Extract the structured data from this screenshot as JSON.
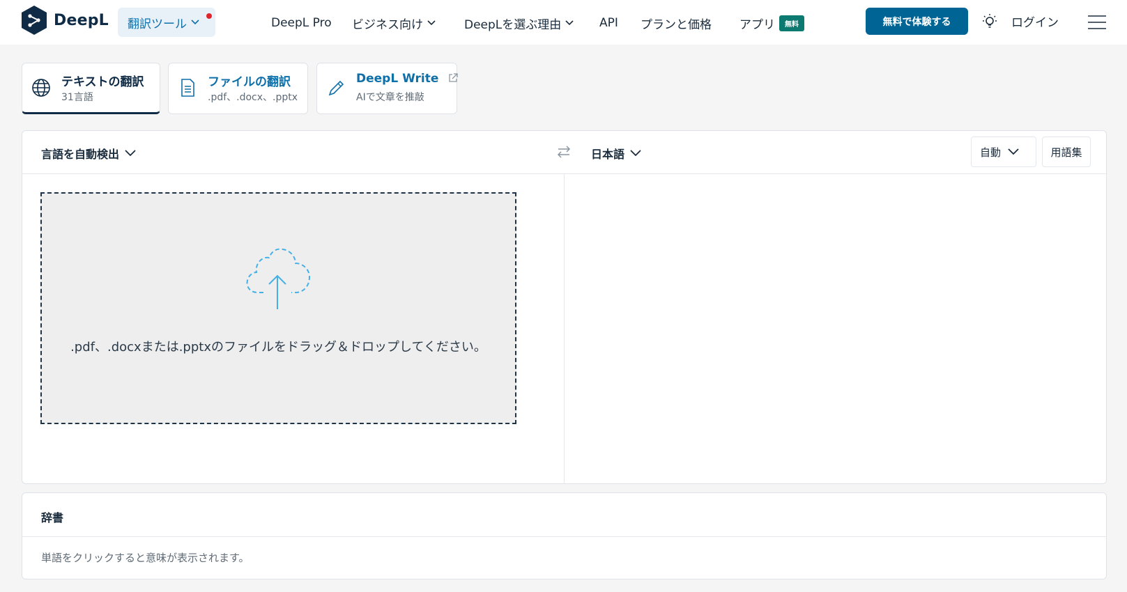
{
  "header": {
    "logo_text": "DeepL",
    "tools_label": "翻訳ツール",
    "nav": [
      {
        "label": "DeepL Pro",
        "dropdown": false
      },
      {
        "label": "ビジネス向け",
        "dropdown": true
      },
      {
        "label": "DeepLを選ぶ理由",
        "dropdown": true
      },
      {
        "label": "API",
        "dropdown": false
      },
      {
        "label": "プランと価格",
        "dropdown": false
      },
      {
        "label": "アプリ",
        "dropdown": false
      }
    ],
    "free_badge": "無料",
    "trial_button": "無料で体験する",
    "login": "ログイン"
  },
  "tabs": [
    {
      "title": "テキストの翻訳",
      "subtitle": "31言語",
      "active": true,
      "icon": "globe-icon"
    },
    {
      "title": "ファイルの翻訳",
      "subtitle": ".pdf、.docx、.pptx",
      "active": false,
      "icon": "document-icon"
    },
    {
      "title": "DeepL Write",
      "subtitle": "AIで文章を推敲",
      "active": false,
      "icon": "pen-icon"
    }
  ],
  "translator": {
    "source_lang": "言語を自動検出",
    "target_lang": "日本語",
    "formality": "自動",
    "glossary": "用語集",
    "drop_text": ".pdf、.docxまたは.pptxのファイルをドラッグ＆ドロップしてください。"
  },
  "dictionary": {
    "title": "辞書",
    "hint": "単語をクリックすると意味が表示されます。"
  },
  "colors": {
    "brand_navy": "#0f2b46",
    "link_blue": "#0f6fa8",
    "cta_blue": "#006494",
    "badge_green": "#0c7a70",
    "cloud_blue": "#45b0e6"
  }
}
